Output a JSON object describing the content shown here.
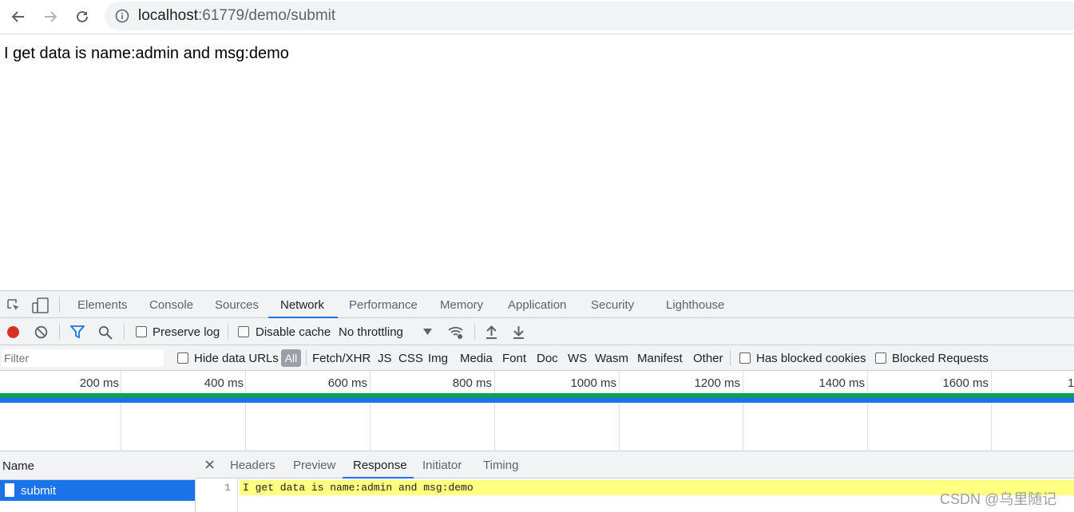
{
  "browser": {
    "url_host": "localhost",
    "url_rest": ":61779/demo/submit"
  },
  "page": {
    "text": "I get data is name:admin and msg:demo"
  },
  "devtools": {
    "tabs": [
      "Elements",
      "Console",
      "Sources",
      "Network",
      "Performance",
      "Memory",
      "Application",
      "Security",
      "Lighthouse"
    ],
    "active_tab": "Network",
    "toolbar": {
      "preserve_log": "Preserve log",
      "disable_cache": "Disable cache",
      "throttling": "No throttling"
    },
    "filterbar": {
      "filter_placeholder": "Filter",
      "hide_data_urls": "Hide data URLs",
      "types": [
        "All",
        "Fetch/XHR",
        "JS",
        "CSS",
        "Img",
        "Media",
        "Font",
        "Doc",
        "WS",
        "Wasm",
        "Manifest",
        "Other"
      ],
      "has_blocked_cookies": "Has blocked cookies",
      "blocked_requests": "Blocked Requests"
    },
    "overview_ticks": [
      "200 ms",
      "400 ms",
      "600 ms",
      "800 ms",
      "1000 ms",
      "1200 ms",
      "1400 ms",
      "1600 ms",
      "1"
    ],
    "name_column": {
      "header": "Name",
      "requests": [
        "submit"
      ]
    },
    "detail_tabs": [
      "Headers",
      "Preview",
      "Response",
      "Initiator",
      "Timing"
    ],
    "active_detail_tab": "Response",
    "response": {
      "line_number": "1",
      "body": "I get data is name:admin and msg:demo"
    }
  },
  "watermark": "CSDN @乌里随记",
  "colors": {
    "accent": "#1a73e8",
    "record": "#d93025",
    "waterfall_green": "#0f9d58",
    "highlight": "#ffff80"
  }
}
